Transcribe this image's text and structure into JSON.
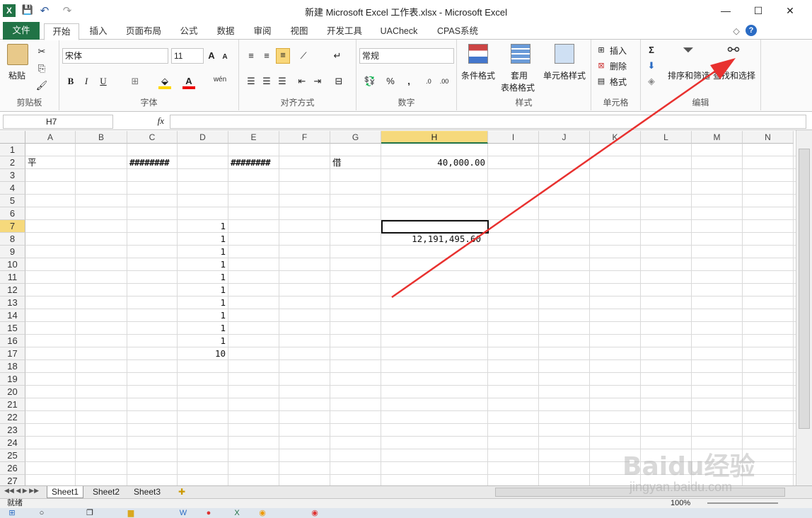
{
  "window": {
    "title": "新建 Microsoft Excel 工作表.xlsx - Microsoft Excel",
    "controls": {
      "minimize": "—",
      "maximize": "☐",
      "close": "✕"
    }
  },
  "quick_access": {
    "app_icon": "X",
    "save": "💾",
    "undo": "↶",
    "redo": "↷"
  },
  "ribbon_tabs": [
    "文件",
    "开始",
    "插入",
    "页面布局",
    "公式",
    "数据",
    "审阅",
    "视图",
    "开发工具",
    "UACheck",
    "CPAS系统"
  ],
  "ribbon_right_icons": {
    "minimize_ribbon": "◇",
    "help": "?"
  },
  "ribbon": {
    "clipboard": {
      "paste": "粘贴",
      "label": "剪贴板"
    },
    "font": {
      "name": "宋体",
      "size": "11",
      "bold": "B",
      "italic": "I",
      "underline": "U",
      "grow": "A",
      "shrink": "A",
      "color": "A",
      "phonetic": "wén",
      "label": "字体"
    },
    "alignment": {
      "label": "对齐方式"
    },
    "number": {
      "format": "常规",
      "percent": "%",
      "comma": ",",
      "label": "数字"
    },
    "styles": {
      "conditional": "条件格式",
      "table1": "套用",
      "table2": "表格格式",
      "cell_styles": "单元格样式",
      "label": "样式"
    },
    "cells": {
      "insert": "插入",
      "delete": "删除",
      "format": "格式",
      "label": "单元格"
    },
    "editing": {
      "sigma": "Σ",
      "sort": "排序和筛选",
      "find": "查找和选择",
      "label": "编辑"
    }
  },
  "formula_bar": {
    "name_box": "H7",
    "fx": "fx",
    "content": ""
  },
  "columns": [
    "A",
    "B",
    "C",
    "D",
    "E",
    "F",
    "G",
    "H",
    "I",
    "J",
    "K",
    "L",
    "M",
    "N"
  ],
  "selected_column": "H",
  "rows": [
    "1",
    "2",
    "3",
    "4",
    "5",
    "6",
    "7",
    "8",
    "9",
    "10",
    "11",
    "12",
    "13",
    "14",
    "15",
    "16",
    "17",
    "18",
    "19",
    "20",
    "21",
    "22",
    "23",
    "24",
    "25",
    "26",
    "27"
  ],
  "selected_row": "7",
  "cells": {
    "A2": "平",
    "C2": "########",
    "E2": "########",
    "G2": "借",
    "H2": "40,000.00",
    "D7": "1",
    "D8": "1",
    "D9": "1",
    "D10": "1",
    "D11": "1",
    "D12": "1",
    "D13": "1",
    "D14": "1",
    "D15": "1",
    "D16": "1",
    "D17": "10",
    "H8": "12,191,495.60"
  },
  "sheets": [
    "Sheet1",
    "Sheet2",
    "Sheet3"
  ],
  "active_sheet": "Sheet1",
  "status": {
    "ready": "就绪",
    "zoom": "100%"
  },
  "watermark": {
    "brand": "Baidu经验",
    "url": "jingyan.baidu.com"
  },
  "accent_colors": {
    "excel_green": "#217346",
    "selection_yellow": "#f6d97c",
    "annotation_red": "#e8312f"
  },
  "annotation": {
    "type": "arrow",
    "points_to": "查找和选择"
  }
}
